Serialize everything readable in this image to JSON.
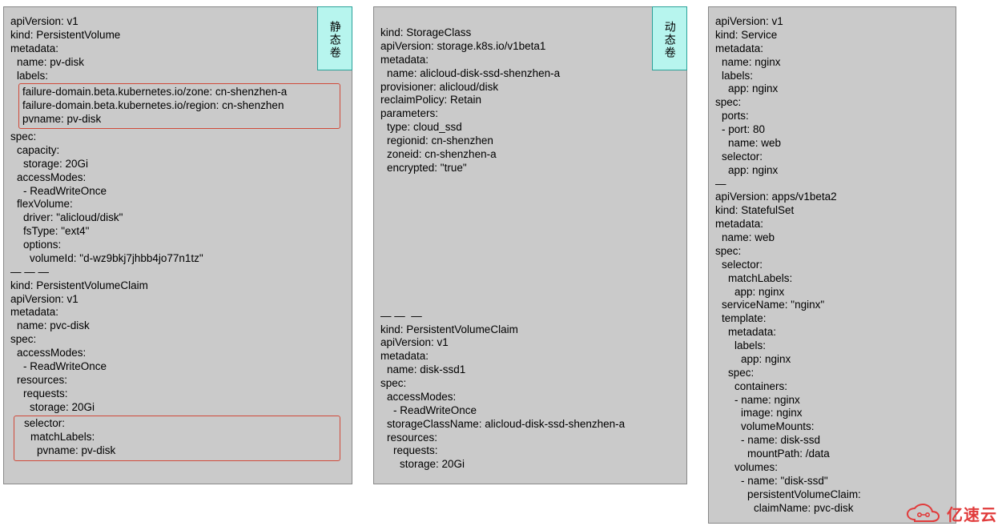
{
  "panel1": {
    "badge": "静态卷",
    "l0": "apiVersion: v1",
    "l1": "kind: PersistentVolume",
    "l2": "metadata:",
    "l3": "name: pv-disk",
    "l4": "labels:",
    "hl1": "failure-domain.beta.kubernetes.io/zone: cn-shenzhen-a",
    "hl2": "failure-domain.beta.kubernetes.io/region: cn-shenzhen",
    "hl3": "pvname: pv-disk",
    "l5": "spec:",
    "l6": "capacity:",
    "l7": "storage: 20Gi",
    "l8": "accessModes:",
    "l9": "- ReadWriteOnce",
    "l10": "flexVolume:",
    "l11": "driver: \"alicloud/disk\"",
    "l12": "fsType: \"ext4\"",
    "l13": "options:",
    "l14": "volumeId: \"d-wz9bkj7jhbb4jo77n1tz\"",
    "sep": "— — —",
    "b0": "kind: PersistentVolumeClaim",
    "b1": "apiVersion: v1",
    "b2": "metadata:",
    "b3": "name: pvc-disk",
    "b4": "spec:",
    "b5": "accessModes:",
    "b6": "- ReadWriteOnce",
    "b7": "resources:",
    "b8": "requests:",
    "b9": "storage: 20Gi",
    "bh1": "selector:",
    "bh2": "matchLabels:",
    "bh3": "pvname: pv-disk"
  },
  "panel2": {
    "badge": "动态卷",
    "l0": "kind: StorageClass",
    "l1": "apiVersion: storage.k8s.io/v1beta1",
    "l2": "metadata:",
    "l3": "name: alicloud-disk-ssd-shenzhen-a",
    "l4": "provisioner: alicloud/disk",
    "l5": "reclaimPolicy: Retain",
    "l6": "parameters:",
    "l7": "type: cloud_ssd",
    "l8": "regionid: cn-shenzhen",
    "l9": "zoneid: cn-shenzhen-a",
    "l10": "encrypted: \"true\"",
    "sep": "— —  —",
    "b0": "kind: PersistentVolumeClaim",
    "b1": "apiVersion: v1",
    "b2": "metadata:",
    "b3": "name: disk-ssd1",
    "b4": "spec:",
    "b5": "accessModes:",
    "b6": "- ReadWriteOnce",
    "b7": "storageClassName: alicloud-disk-ssd-shenzhen-a",
    "b8": "resources:",
    "b9": "requests:",
    "b10": "storage: 20Gi"
  },
  "panel3": {
    "l0": "apiVersion: v1",
    "l1": "kind: Service",
    "l2": "metadata:",
    "l3": "name: nginx",
    "l4": "labels:",
    "l5": "app: nginx",
    "l6": "spec:",
    "l7": "ports:",
    "l8": "- port: 80",
    "l9": "name: web",
    "l10": "selector:",
    "l11": "app: nginx",
    "l12": "—",
    "l13": "apiVersion: apps/v1beta2",
    "l14": "kind: StatefulSet",
    "l15": "metadata:",
    "l16": "name: web",
    "l17": "spec:",
    "l18": "selector:",
    "l19": "matchLabels:",
    "l20": "app: nginx",
    "l21": "serviceName: \"nginx\"",
    "l22": "template:",
    "l23": "metadata:",
    "l24": "labels:",
    "l25": "app: nginx",
    "l26": "spec:",
    "l27": "containers:",
    "l28": "- name: nginx",
    "l29": "image: nginx",
    "l30": "volumeMounts:",
    "l31": "- name: disk-ssd",
    "l32": "mountPath: /data",
    "l33": "volumes:",
    "l34": "- name: \"disk-ssd\"",
    "l35": "persistentVolumeClaim:",
    "l36": "claimName: pvc-disk"
  },
  "watermark": "亿速云"
}
